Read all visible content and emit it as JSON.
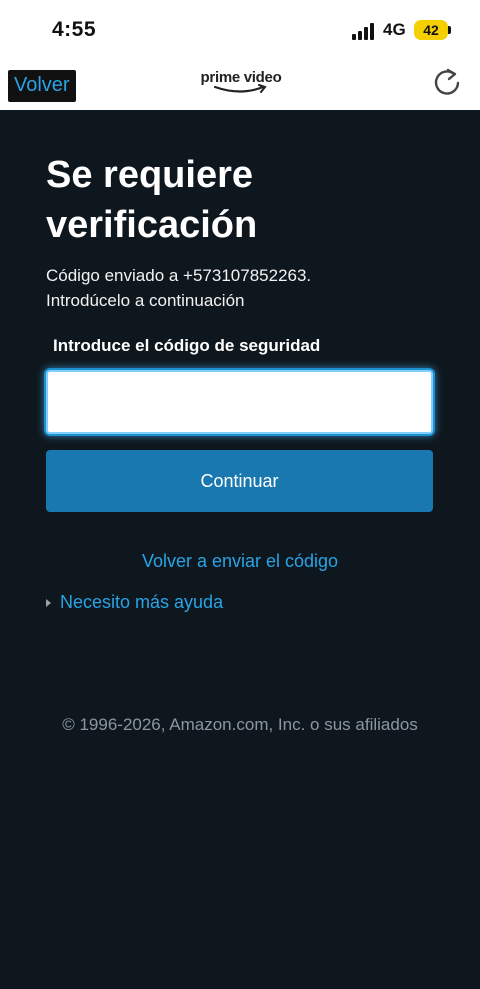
{
  "status_bar": {
    "time": "4:55",
    "network": "4G",
    "battery": "42",
    "battery_color": "#f5d000"
  },
  "nav": {
    "back_label": "Volver",
    "logo_text": "prime video",
    "refresh_icon": "refresh-icon"
  },
  "main": {
    "title": "Se requiere verificación",
    "sent_line1": "Código enviado a +573107852263.",
    "sent_line2": "Introdúcelo a continuación",
    "code_label": "Introduce el código de seguridad",
    "code_value": "",
    "continue_label": "Continuar",
    "resend_label": "Volver a enviar el código",
    "help_label": "Necesito más ayuda",
    "copyright": "© 1996-2026, Amazon.com, Inc. o sus afiliados"
  },
  "colors": {
    "background": "#0f171e",
    "accent": "#2aa3e6",
    "button": "#1a78b0"
  }
}
